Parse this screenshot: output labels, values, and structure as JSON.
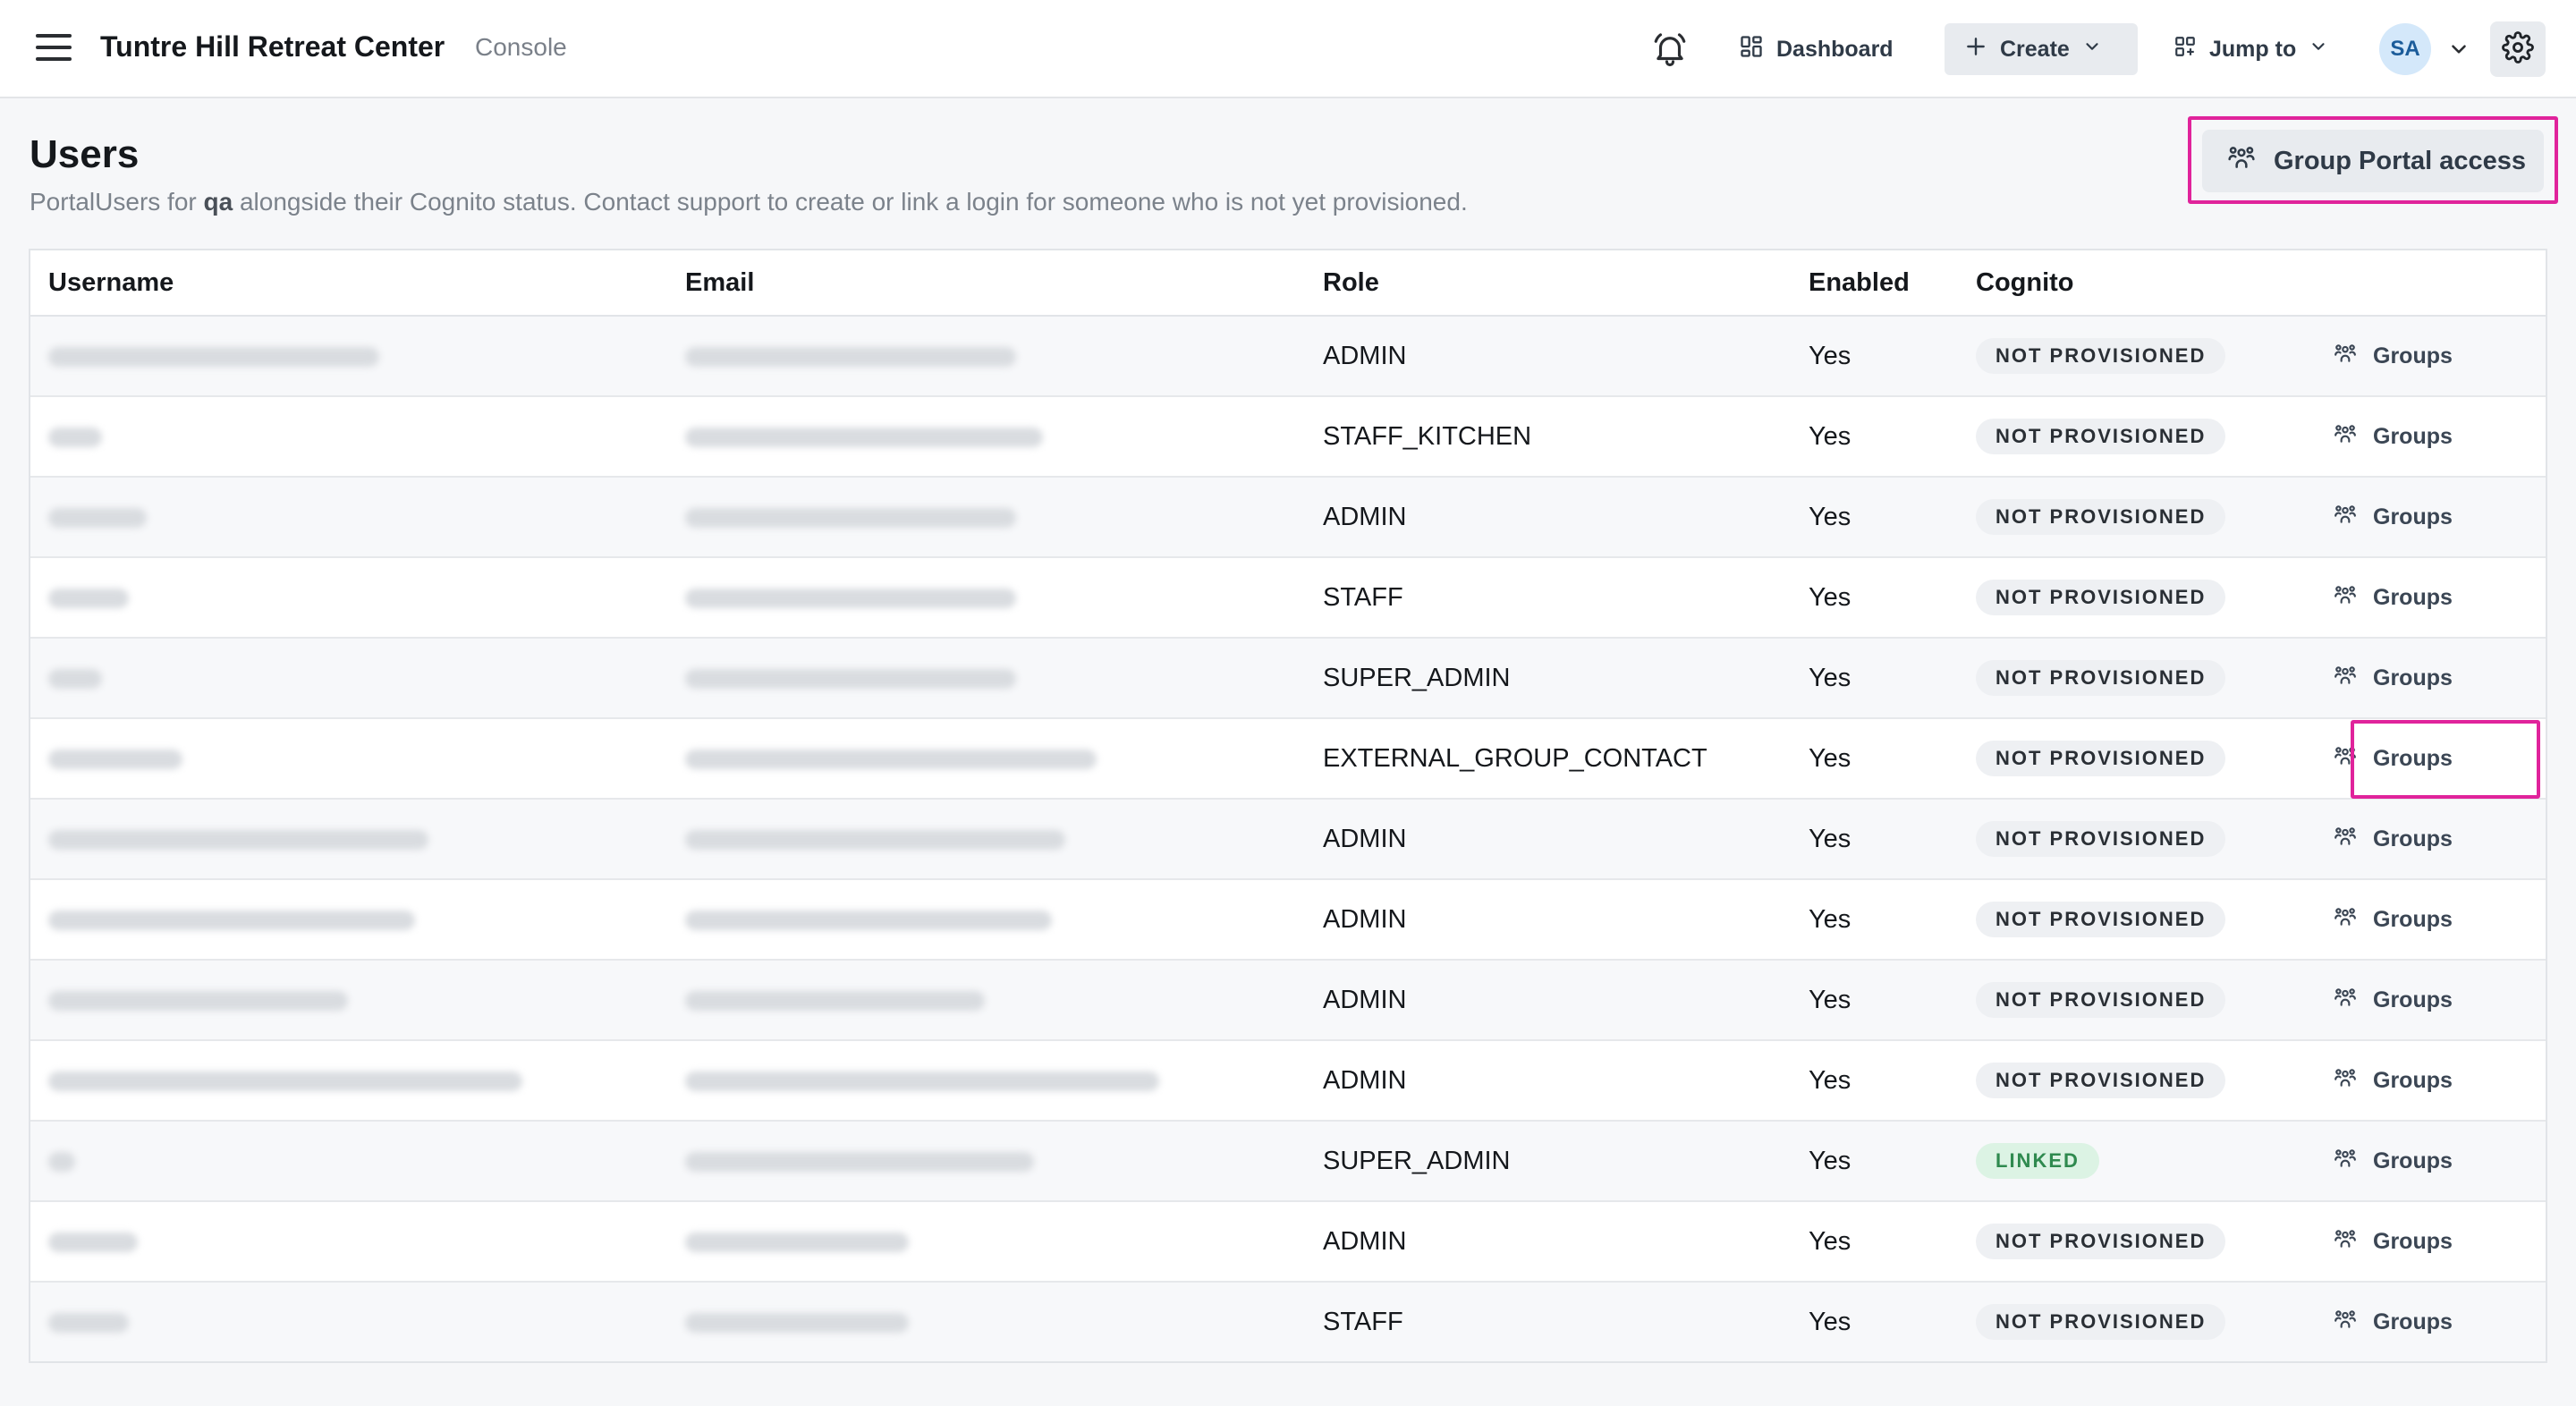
{
  "header": {
    "app_title": "Tuntre Hill Retreat Center",
    "app_subtitle": "Console",
    "dashboard_label": "Dashboard",
    "create_label": "Create",
    "jump_label": "Jump to",
    "avatar_initials": "SA"
  },
  "page": {
    "title": "Users",
    "desc_part1": "PortalUsers for ",
    "desc_bold": "qa",
    "desc_part2": " alongside their Cognito status. Contact support to create or link a login for someone who is not yet provisioned.",
    "group_portal_button": "Group Portal access"
  },
  "table": {
    "columns": [
      "Username",
      "Email",
      "Role",
      "Enabled",
      "Cognito"
    ],
    "action_label": "Groups",
    "rows": [
      {
        "role": "ADMIN",
        "enabled": "Yes",
        "cognito": "NOT PROVISIONED"
      },
      {
        "role": "STAFF_KITCHEN",
        "enabled": "Yes",
        "cognito": "NOT PROVISIONED"
      },
      {
        "role": "ADMIN",
        "enabled": "Yes",
        "cognito": "NOT PROVISIONED"
      },
      {
        "role": "STAFF",
        "enabled": "Yes",
        "cognito": "NOT PROVISIONED"
      },
      {
        "role": "SUPER_ADMIN",
        "enabled": "Yes",
        "cognito": "NOT PROVISIONED"
      },
      {
        "role": "EXTERNAL_GROUP_CONTACT",
        "enabled": "Yes",
        "cognito": "NOT PROVISIONED"
      },
      {
        "role": "ADMIN",
        "enabled": "Yes",
        "cognito": "NOT PROVISIONED"
      },
      {
        "role": "ADMIN",
        "enabled": "Yes",
        "cognito": "NOT PROVISIONED"
      },
      {
        "role": "ADMIN",
        "enabled": "Yes",
        "cognito": "NOT PROVISIONED"
      },
      {
        "role": "ADMIN",
        "enabled": "Yes",
        "cognito": "NOT PROVISIONED"
      },
      {
        "role": "SUPER_ADMIN",
        "enabled": "Yes",
        "cognito": "LINKED"
      },
      {
        "role": "ADMIN",
        "enabled": "Yes",
        "cognito": "NOT PROVISIONED"
      },
      {
        "role": "STAFF",
        "enabled": "Yes",
        "cognito": "NOT PROVISIONED"
      }
    ]
  },
  "colors": {
    "accent_highlight": "#e0239b",
    "linked_badge": "#2f8a4f",
    "avatar_bg": "#d4e8fa"
  },
  "icons": [
    "menu-icon",
    "bell-icon",
    "dashboard-icon",
    "plus-icon",
    "chevron-down-icon",
    "jump-icon",
    "gear-icon",
    "group-icon"
  ]
}
